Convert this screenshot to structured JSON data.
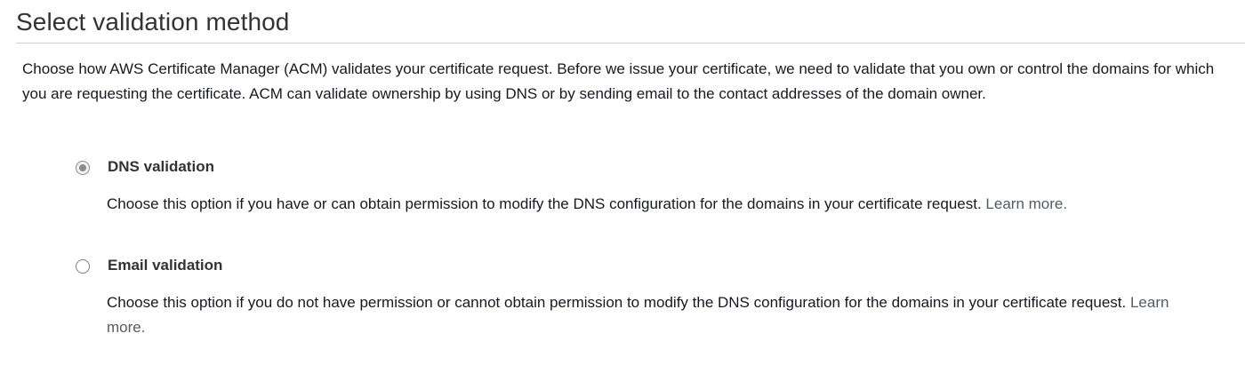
{
  "section": {
    "title": "Select validation method",
    "description": "Choose how AWS Certificate Manager (ACM) validates your certificate request. Before we issue your certificate, we need to validate that you own or control the domains for which you are requesting the certificate. ACM can validate ownership by using DNS or by sending email to the contact addresses of the domain owner."
  },
  "options": [
    {
      "label": "DNS validation",
      "selected": true,
      "description": "Choose this option if you have or can obtain permission to modify the DNS configuration for the domains in your certificate request.",
      "link_text": "Learn more."
    },
    {
      "label": "Email validation",
      "selected": false,
      "description": "Choose this option if you do not have permission or cannot obtain permission to modify the DNS configuration for the domains in your certificate request.",
      "link_text": "Learn more."
    }
  ],
  "colors": {
    "text": "#16191f",
    "heading": "#333333",
    "link": "#545b64",
    "divider": "#cfcfcf"
  }
}
